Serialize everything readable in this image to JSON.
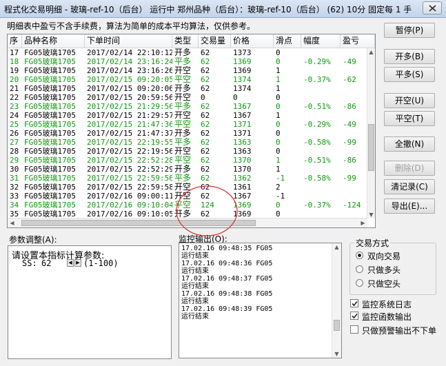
{
  "window": {
    "title": "程式化交易明细 - 玻璃-ref-10（后台） 运行中  郑州品种（后台）：玻璃-ref-10（后台） (62) 10分 固定每 1 手"
  },
  "hint": "明细表中盈亏不含手续费，算法为简单的成本平均算法，仅供参考。",
  "table": {
    "headers": [
      "序",
      "品种名称",
      "下单时间",
      "类型",
      "交易量",
      "价格",
      "滑点",
      "幅度",
      "盈亏"
    ],
    "rows": [
      {
        "seq": "17",
        "name": "FG05玻璃1705",
        "time": "2017/02/14 22:10:12",
        "type": "开多",
        "qty": "62",
        "price": "1373",
        "slip": "0",
        "range": "",
        "pnl": "",
        "green": false
      },
      {
        "seq": "18",
        "name": "FG05玻璃1705",
        "time": "2017/02/14 23:16:24",
        "type": "平多",
        "qty": "62",
        "price": "1369",
        "slip": "0",
        "range": "-0.29%",
        "pnl": "-49",
        "green": true
      },
      {
        "seq": "19",
        "name": "FG05玻璃1705",
        "time": "2017/02/14 23:16:26",
        "type": "开空",
        "qty": "62",
        "price": "1369",
        "slip": "1",
        "range": "",
        "pnl": "",
        "green": false
      },
      {
        "seq": "20",
        "name": "FG05玻璃1705",
        "time": "2017/02/15 09:20:05",
        "type": "平空",
        "qty": "62",
        "price": "1374",
        "slip": "1",
        "range": "-0.37%",
        "pnl": "-62",
        "green": true
      },
      {
        "seq": "21",
        "name": "FG05玻璃1705",
        "time": "2017/02/15 09:20:06",
        "type": "开多",
        "qty": "62",
        "price": "1374",
        "slip": "1",
        "range": "",
        "pnl": "",
        "green": false
      },
      {
        "seq": "22",
        "name": "FG05玻璃1705",
        "time": "2017/02/15 20:59:56",
        "type": "开空",
        "qty": "0",
        "price": "0",
        "slip": "0",
        "range": "",
        "pnl": "",
        "green": false
      },
      {
        "seq": "23",
        "name": "FG05玻璃1705",
        "time": "2017/02/15 21:29:56",
        "type": "平多",
        "qty": "62",
        "price": "1367",
        "slip": "0",
        "range": "-0.51%",
        "pnl": "-86",
        "green": true
      },
      {
        "seq": "24",
        "name": "FG05玻璃1705",
        "time": "2017/02/15 21:29:57",
        "type": "开空",
        "qty": "62",
        "price": "1367",
        "slip": "1",
        "range": "",
        "pnl": "",
        "green": false
      },
      {
        "seq": "25",
        "name": "FG05玻璃1705",
        "time": "2017/02/15 21:47:36",
        "type": "平空",
        "qty": "62",
        "price": "1371",
        "slip": "0",
        "range": "-0.29%",
        "pnl": "-49",
        "green": true
      },
      {
        "seq": "26",
        "name": "FG05玻璃1705",
        "time": "2017/02/15 21:47:37",
        "type": "开多",
        "qty": "62",
        "price": "1371",
        "slip": "0",
        "range": "",
        "pnl": "",
        "green": false
      },
      {
        "seq": "27",
        "name": "FG05玻璃1705",
        "time": "2017/02/15 22:19:55",
        "type": "平多",
        "qty": "62",
        "price": "1363",
        "slip": "0",
        "range": "-0.58%",
        "pnl": "-99",
        "green": true
      },
      {
        "seq": "28",
        "name": "FG05玻璃1705",
        "time": "2017/02/15 22:19:56",
        "type": "开空",
        "qty": "62",
        "price": "1363",
        "slip": "0",
        "range": "",
        "pnl": "",
        "green": false
      },
      {
        "seq": "29",
        "name": "FG05玻璃1705",
        "time": "2017/02/15 22:52:28",
        "type": "平空",
        "qty": "62",
        "price": "1370",
        "slip": "1",
        "range": "-0.51%",
        "pnl": "-86",
        "green": true
      },
      {
        "seq": "30",
        "name": "FG05玻璃1705",
        "time": "2017/02/15 22:52:29",
        "type": "开多",
        "qty": "62",
        "price": "1370",
        "slip": "1",
        "range": "",
        "pnl": "",
        "green": false
      },
      {
        "seq": "31",
        "name": "FG05玻璃1705",
        "time": "2017/02/15 22:59:56",
        "type": "平多",
        "qty": "62",
        "price": "1362",
        "slip": "-1",
        "range": "-0.58%",
        "pnl": "-99",
        "green": true
      },
      {
        "seq": "32",
        "name": "FG05玻璃1705",
        "time": "2017/02/15 22:59:58",
        "type": "开空",
        "qty": "62",
        "price": "1361",
        "slip": "2",
        "range": "",
        "pnl": "",
        "green": false
      },
      {
        "seq": "33",
        "name": "FG05玻璃1705",
        "time": "2017/02/16 09:00:11",
        "type": "开空",
        "qty": "62",
        "price": "1367",
        "slip": "-1",
        "range": "",
        "pnl": "",
        "green": false
      },
      {
        "seq": "34",
        "name": "FG05玻璃1705",
        "time": "2017/02/16 09:10:04",
        "type": "平空",
        "qty": "124",
        "price": "1369",
        "slip": "0",
        "range": "-0.37%",
        "pnl": "-124",
        "green": true
      },
      {
        "seq": "35",
        "name": "FG05玻璃1705",
        "time": "2017/02/16 09:10:05",
        "type": "开多",
        "qty": "62",
        "price": "1369",
        "slip": "0",
        "range": "",
        "pnl": "",
        "green": false
      }
    ]
  },
  "buttons": {
    "pause": "暂停(P)",
    "open_long": "开多(B)",
    "close_long": "平多(S)",
    "open_short": "开空(U)",
    "close_short": "平空(T)",
    "cancel_all": "全撤(N)",
    "delete": "删除(D)",
    "clear_log": "清记录(C)",
    "export": "导出(E)..."
  },
  "params": {
    "label": "参数调整(A):",
    "prompt": "请设置本指标计算参数:",
    "ss_label": "SS:",
    "ss_value": "62",
    "ss_range": "(1-100)"
  },
  "monitor": {
    "label": "监控输出(O):",
    "lines": [
      "17.02.16 09:48:35 FG05",
      "运行结束",
      "17.02.16 09:48:36 FG05",
      "运行结束",
      "17.02.16 09:48:37 FG05",
      "运行结束",
      "17.02.16 09:48:38 FG05",
      "运行结束",
      "17.02.16 09:48:39 FG05",
      "运行结束"
    ]
  },
  "trade_mode": {
    "legend": "交易方式",
    "options": [
      {
        "label": "双向交易",
        "selected": true
      },
      {
        "label": "只做多头",
        "selected": false
      },
      {
        "label": "只做空头",
        "selected": false
      }
    ]
  },
  "checkboxes": [
    {
      "label": "监控系统日志",
      "checked": true
    },
    {
      "label": "监控函数输出",
      "checked": true
    },
    {
      "label": "只做预警输出不下单",
      "checked": false
    }
  ],
  "colors": {
    "green_row_text": "#0c9a0c",
    "annotation_circle": "#e03030"
  }
}
